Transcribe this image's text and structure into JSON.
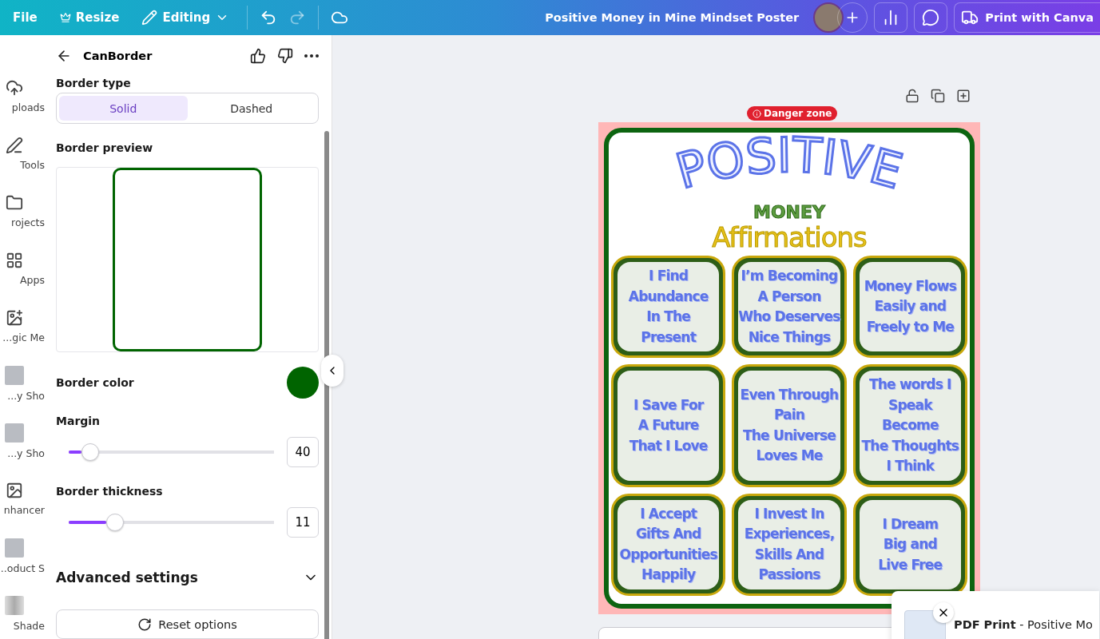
{
  "topbar": {
    "menu": [
      {
        "kind": "file",
        "label": "File"
      },
      {
        "kind": "resize",
        "label": "Resize"
      },
      {
        "kind": "editing",
        "label": "Editing"
      }
    ],
    "title": "Positive Money in Mine Mindset Poster",
    "print_button": "Print with Canva"
  },
  "rail": [
    {
      "kind": "upload",
      "label": "ploads"
    },
    {
      "kind": "tools",
      "label": "Tools"
    },
    {
      "kind": "projects",
      "label": "rojects"
    },
    {
      "kind": "apps",
      "label": "Apps"
    },
    {
      "kind": "magic",
      "label": "gic Me..."
    },
    {
      "kind": "thumb",
      "label": "y Sho..."
    },
    {
      "kind": "thumb",
      "label": "y Sho..."
    },
    {
      "kind": "enhancer",
      "label": "nhancer"
    },
    {
      "kind": "thumb",
      "label": "oduct S..."
    },
    {
      "kind": "shade",
      "label": "Shade"
    }
  ],
  "panel": {
    "title": "CanBorder",
    "border_type": {
      "label": "Border type",
      "options": [
        {
          "label": "Solid",
          "selected": true
        },
        {
          "label": "Dashed",
          "selected": false
        }
      ]
    },
    "preview_label": "Border preview",
    "color_label": "Border color",
    "color": "#006400",
    "sliders": [
      {
        "label": "Margin",
        "value": "40",
        "level": 0.07
      },
      {
        "label": "Border thickness",
        "value": "11",
        "level": 0.2
      }
    ],
    "advanced": {
      "label": "Advanced settings",
      "expanded": false
    },
    "reset_button": "Reset options"
  },
  "canvas": {
    "badge": "Danger zone",
    "poster": {
      "title": "POSITIVE",
      "subtitle": "MONEY",
      "heading": "Affirmations",
      "cards": [
        {
          "lines": [
            "I Find",
            "Abundance",
            "In The",
            "Present"
          ]
        },
        {
          "lines": [
            "I’m Becoming",
            "A Person",
            "Who Deserves",
            "Nice Things"
          ]
        },
        {
          "lines": [
            "Money Flows",
            "Easily and",
            "Freely to Me"
          ]
        },
        {
          "lines": [
            "I Save For",
            "A Future",
            "That I Love"
          ]
        },
        {
          "lines": [
            "Even Through",
            "Pain",
            "The Universe",
            "Loves Me"
          ]
        },
        {
          "lines": [
            "The words I",
            "Speak",
            "Become",
            "The Thoughts",
            "I Think"
          ]
        },
        {
          "lines": [
            "I Accept",
            "Gifts And",
            "Opportunities",
            "Happily"
          ]
        },
        {
          "lines": [
            "I Invest In",
            "Experiences,",
            "Skills And",
            "Passions"
          ]
        },
        {
          "lines": [
            "I Dream",
            "Big and",
            "Live Free"
          ]
        }
      ]
    }
  },
  "toast": {
    "text": "**PDF Print** - Positive Mo"
  }
}
